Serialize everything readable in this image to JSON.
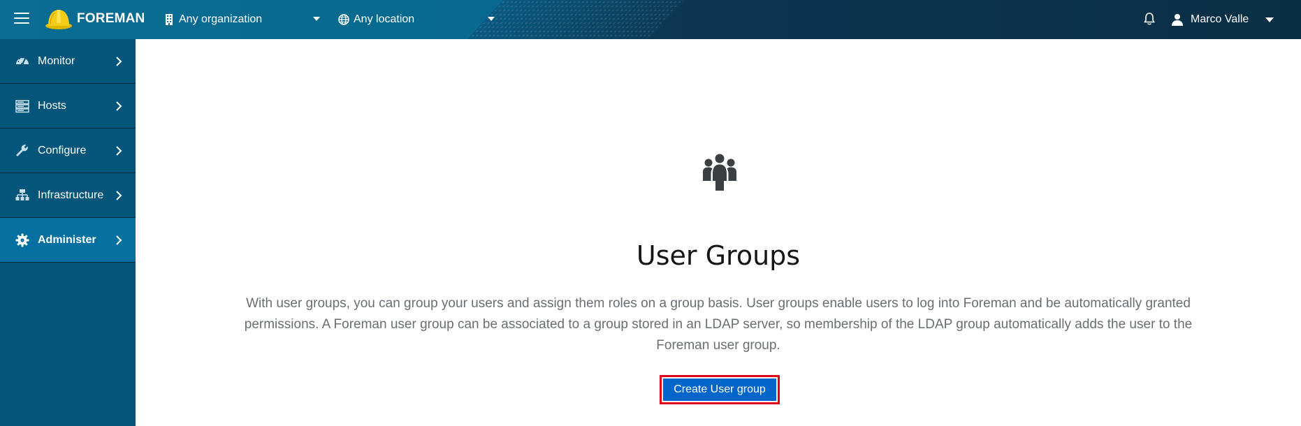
{
  "app": {
    "brand": "FOREMAN"
  },
  "header": {
    "organization": "Any organization",
    "location": "Any location",
    "user_name": "Marco Valle"
  },
  "sidebar": {
    "items": [
      {
        "label": "Monitor",
        "icon": "dashboard-gauge-icon",
        "active": false
      },
      {
        "label": "Hosts",
        "icon": "server-icon",
        "active": false
      },
      {
        "label": "Configure",
        "icon": "wrench-icon",
        "active": false
      },
      {
        "label": "Infrastructure",
        "icon": "network-icon",
        "active": false
      },
      {
        "label": "Administer",
        "icon": "gear-icon",
        "active": true
      }
    ]
  },
  "main": {
    "icon": "users-icon",
    "title": "User Groups",
    "description": "With user groups, you can group your users and assign them roles on a group basis. User groups enable users to log into Foreman and be automatically granted permissions. A Foreman user group can be associated to a group stored in an LDAP server, so membership of the LDAP group automatically adds the user to the Foreman user group.",
    "create_button": "Create User group"
  },
  "colors": {
    "navbar": "#0a6d93",
    "sidebar": "#03557a",
    "sidebar_active": "#0670a0",
    "primary_button": "#0066cc",
    "highlight_border": "#e0001b"
  }
}
